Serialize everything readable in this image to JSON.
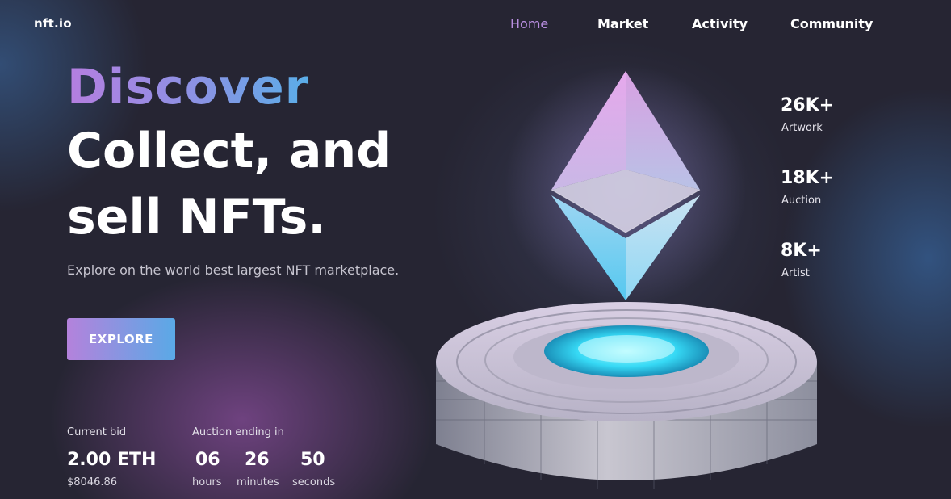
{
  "brand": {
    "logo": "nft.io"
  },
  "nav": {
    "items": [
      {
        "label": "Home",
        "active": true
      },
      {
        "label": "Market",
        "active": false
      },
      {
        "label": "Activity",
        "active": false
      },
      {
        "label": "Community",
        "active": false
      }
    ]
  },
  "hero": {
    "headline_accent": "Discover",
    "headline_line1": "Collect, and",
    "headline_line2": "sell NFTs.",
    "subtitle": "Explore on the world best largest NFT marketplace.",
    "cta_label": "EXPLORE"
  },
  "bid": {
    "label": "Current bid",
    "value": "2.00 ETH",
    "usd": "$8046.86"
  },
  "auction": {
    "label": "Auction ending in",
    "countdown": [
      {
        "value": "06",
        "unit": "hours"
      },
      {
        "value": "26",
        "unit": "minutes"
      },
      {
        "value": "50",
        "unit": "seconds"
      }
    ]
  },
  "stats": [
    {
      "value": "26K+",
      "label": "Artwork"
    },
    {
      "value": "18K+",
      "label": "Auction"
    },
    {
      "value": "8K+",
      "label": "Artist"
    }
  ],
  "artwork": {
    "icon": "ethereum-icon"
  },
  "colors": {
    "background": "#262533",
    "accent_purple": "#b482dc",
    "accent_blue": "#5aa9e6",
    "nav_active": "#b88ee0"
  }
}
